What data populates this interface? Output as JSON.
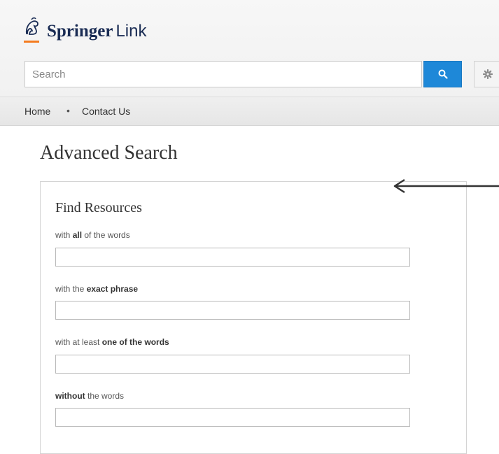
{
  "header": {
    "logo": {
      "brand": "Springer",
      "sub": "Link"
    },
    "search": {
      "placeholder": "Search"
    },
    "search_icon": "search-icon",
    "settings_icon": "gear-icon"
  },
  "nav": {
    "home": "Home",
    "separator": "•",
    "contact": "Contact Us"
  },
  "page": {
    "title": "Advanced Search"
  },
  "panel": {
    "title": "Find Resources",
    "fields": [
      {
        "pre": "with ",
        "bold": "all",
        "post": " of the words",
        "value": ""
      },
      {
        "pre": "with the ",
        "bold": "exact phrase",
        "post": "",
        "value": ""
      },
      {
        "pre": "with at least ",
        "bold": "one of the words",
        "post": "",
        "value": ""
      },
      {
        "pre": "",
        "bold": "without",
        "post": " the words",
        "value": ""
      }
    ]
  },
  "annotation": {
    "arrow": "left-arrow-icon"
  },
  "colors": {
    "accent": "#1e88d8",
    "brand_orange": "#f47c20",
    "brand_navy": "#1a2c54"
  }
}
